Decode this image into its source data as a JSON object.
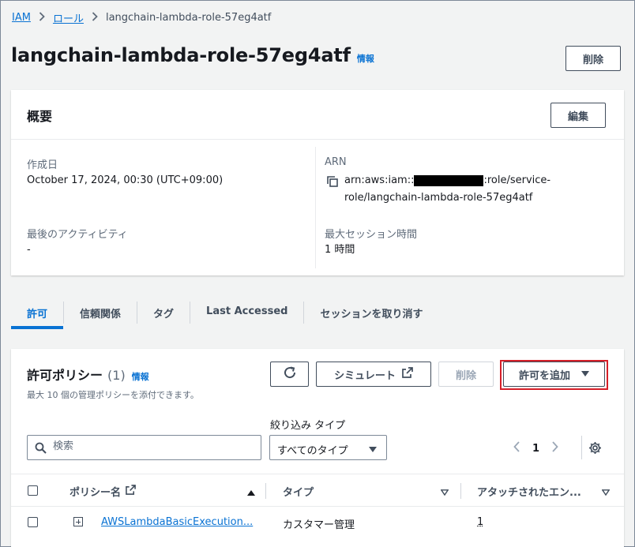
{
  "breadcrumb": {
    "iam": "IAM",
    "roles": "ロール",
    "current": "langchain-lambda-role-57eg4atf"
  },
  "header": {
    "title": "langchain-lambda-role-57eg4atf",
    "info": "情報",
    "delete": "削除"
  },
  "summary": {
    "title": "概要",
    "edit": "編集",
    "created_label": "作成日",
    "created_value": "October 17, 2024, 00:30 (UTC+09:00)",
    "arn_label": "ARN",
    "arn_prefix": "arn:aws:iam::",
    "arn_suffix": ":role/service-",
    "arn_line2": "role/langchain-lambda-role-57eg4atf",
    "last_activity_label": "最後のアクティビティ",
    "last_activity_value": "-",
    "max_session_label": "最大セッション時間",
    "max_session_value": "1 時間"
  },
  "tabs": [
    "許可",
    "信頼関係",
    "タグ",
    "Last Accessed",
    "セッションを取り消す"
  ],
  "policies": {
    "title": "許可ポリシー",
    "count": "(1)",
    "info": "情報",
    "desc": "最大 10 個の管理ポリシーを添付できます。",
    "simulate": "シミュレート",
    "delete": "削除",
    "add": "許可を追加",
    "filter_label": "絞り込み タイプ",
    "search_placeholder": "検索",
    "filter_value": "すべてのタイプ",
    "page": "1",
    "columns": {
      "name": "ポリシー名",
      "type": "タイプ",
      "attached": "アタッチされたエン..."
    },
    "rows": [
      {
        "name": "AWSLambdaBasicExecution...",
        "type": "カスタマー管理",
        "attached": "1"
      }
    ]
  },
  "colors": {
    "link": "#0972d3",
    "highlight": "#d61f28"
  }
}
